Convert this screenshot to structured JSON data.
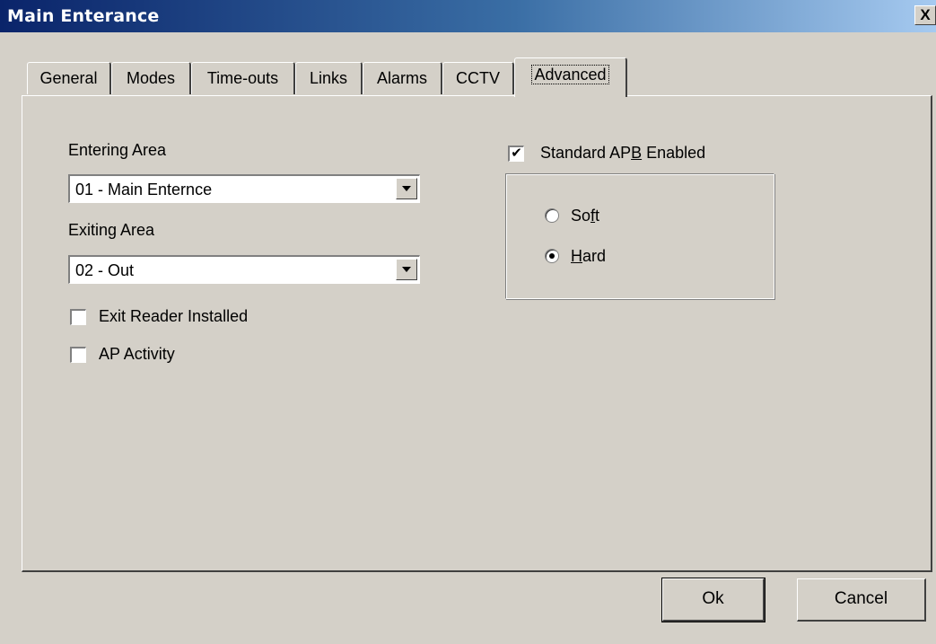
{
  "window": {
    "title": "Main Enterance",
    "close_label": "X"
  },
  "tabs": [
    {
      "label": "General"
    },
    {
      "label": "Modes"
    },
    {
      "label": "Time-outs"
    },
    {
      "label": "Links"
    },
    {
      "label": "Alarms"
    },
    {
      "label": "CCTV"
    },
    {
      "label": "Advanced",
      "active": true
    }
  ],
  "advanced": {
    "entering_area": {
      "label": "Entering Area",
      "value": "01 - Main Enternce"
    },
    "exiting_area": {
      "label": "Exiting Area",
      "value": "02 - Out"
    },
    "exit_reader_installed": {
      "label": "Exit Reader Installed",
      "checked": false
    },
    "ap_activity": {
      "label": "AP Activity",
      "checked": false
    },
    "standard_apb": {
      "label_pre": "Standard AP",
      "label_mnemonic": "B",
      "label_post": " Enabled",
      "checked": true,
      "check_glyph": "✔"
    },
    "apb_mode": {
      "options": [
        {
          "pre": "So",
          "mnemonic": "f",
          "post": "t",
          "selected": false
        },
        {
          "pre": "",
          "mnemonic": "H",
          "post": "ard",
          "selected": true
        }
      ]
    }
  },
  "buttons": {
    "ok": "Ok",
    "cancel": "Cancel"
  }
}
